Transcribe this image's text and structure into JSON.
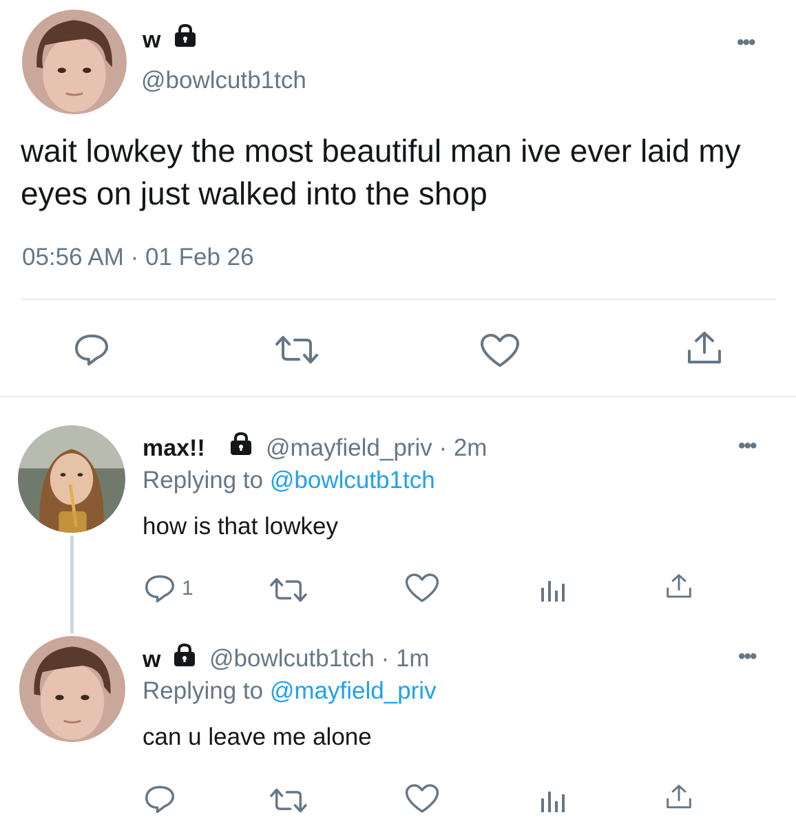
{
  "main_tweet": {
    "display_name": "w",
    "handle": "@bowlcutb1tch",
    "text": "wait lowkey the most beautiful man ive ever laid my eyes on just walked into the shop",
    "timestamp": "05:56 AM · 01 Feb 26",
    "actions": [
      "reply-icon",
      "retweet-icon",
      "like-icon",
      "share-icon"
    ]
  },
  "replies": [
    {
      "display_name": "max!!",
      "handle": "@mayfield_priv",
      "time": "· 2m",
      "replying_prefix": "Replying to",
      "replying_to": "@bowlcutb1tch",
      "text": "how is that lowkey",
      "reply_count": "1"
    },
    {
      "display_name": "w",
      "handle": "@bowlcutb1tch",
      "time": "· 1m",
      "replying_prefix": "Replying to",
      "replying_to": "@mayfield_priv",
      "text": "can u leave me alone",
      "reply_count": ""
    }
  ],
  "more_label": "•••",
  "colors": {
    "text": "#14171a",
    "secondary": "#657786",
    "link": "#1da1f2",
    "divider": "#e6ecf0",
    "thread_line": "#ccd6dd"
  }
}
